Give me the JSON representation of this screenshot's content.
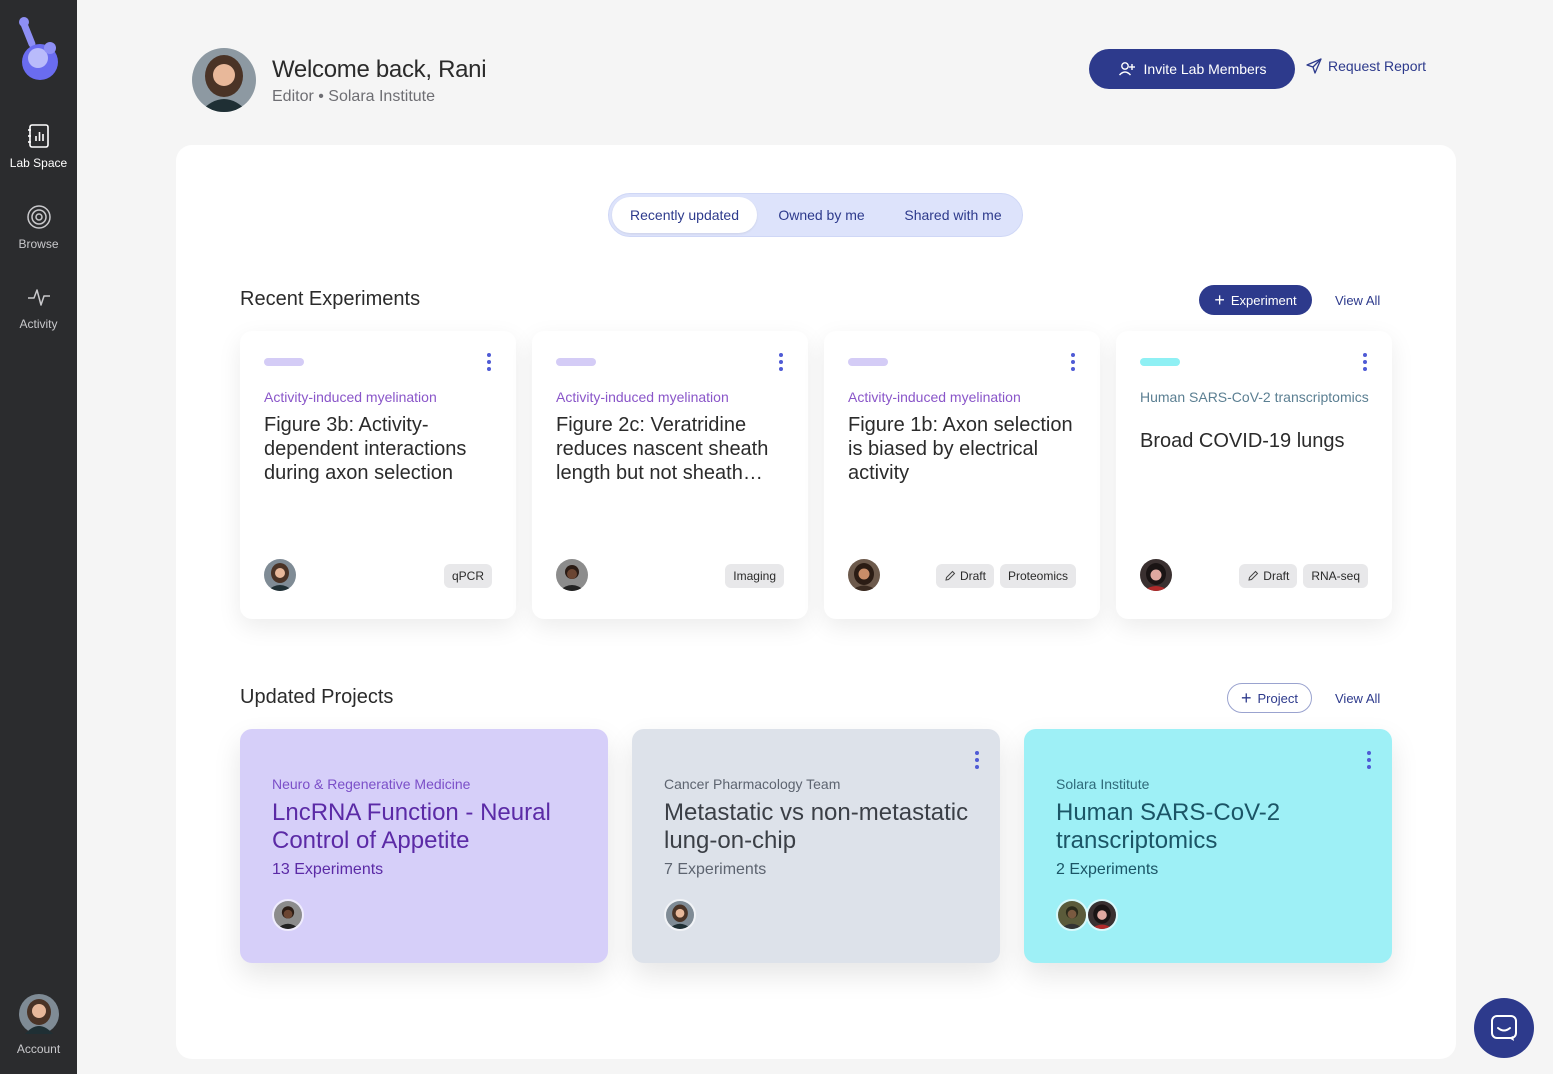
{
  "sidebar": {
    "items": [
      {
        "label": "Lab Space",
        "icon": "notebook-chart-icon",
        "active": true
      },
      {
        "label": "Browse",
        "icon": "target-icon",
        "active": false
      },
      {
        "label": "Activity",
        "icon": "pulse-icon",
        "active": false
      }
    ],
    "account_label": "Account"
  },
  "header": {
    "welcome": "Welcome back, Rani",
    "subtitle": "Editor • Solara Institute",
    "invite_label": "Invite Lab Members",
    "report_label": "Request Report"
  },
  "tabs": {
    "recent": "Recently updated",
    "owned": "Owned by me",
    "shared": "Shared with me",
    "active": "Recently updated"
  },
  "experiments": {
    "title": "Recent Experiments",
    "add_label": "Experiment",
    "view_all": "View All",
    "items": [
      {
        "category": "Activity-induced myelination",
        "title": "Figure 3b: Activity-dependent interactions during axon selection",
        "tags": [
          "qPCR"
        ],
        "draft": false,
        "accent": "#d4ccf6",
        "cat_color": "#8a56c9"
      },
      {
        "category": "Activity-induced myelination",
        "title": "Figure 2c: Veratridine reduces nascent sheath length but not sheath…",
        "tags": [
          "Imaging"
        ],
        "draft": false,
        "accent": "#d4ccf6",
        "cat_color": "#8a56c9"
      },
      {
        "category": "Activity-induced myelination",
        "title": "Figure 1b: Axon selection is biased by electrical activity",
        "tags": [
          "Draft",
          "Proteomics"
        ],
        "draft": true,
        "accent": "#d4ccf6",
        "cat_color": "#8a56c9"
      },
      {
        "category": "Human SARS-CoV-2 transcriptomics",
        "title": "Broad COVID-19 lungs",
        "tags": [
          "Draft",
          "RNA-seq"
        ],
        "draft": true,
        "accent": "#8ff0f4",
        "cat_color": "#5b7f92"
      }
    ]
  },
  "projects": {
    "title": "Updated Projects",
    "add_label": "Project",
    "view_all": "View All",
    "items": [
      {
        "team": "Neuro & Regenerative Medicine",
        "title": "LncRNA Function - Neural Control of Appetite",
        "count": "13 Experiments",
        "bg": "#d6cff9",
        "team_color": "#7b4fc8",
        "title_color": "#5b2aa6",
        "count_color": "#5b2aa6"
      },
      {
        "team": "Cancer Pharmacology Team",
        "title": "Metastatic vs non-metastatic lung-on-chip",
        "count": "7 Experiments",
        "bg": "#dde2ea",
        "team_color": "#5d6470",
        "title_color": "#3b3f46",
        "count_color": "#5d6470"
      },
      {
        "team": "Solara Institute",
        "title": "Human SARS-CoV-2 transcriptomics",
        "count": "2 Experiments",
        "bg": "#9ef0f6",
        "team_color": "#2f6a7a",
        "title_color": "#1b5566",
        "count_color": "#1b5566"
      }
    ]
  }
}
